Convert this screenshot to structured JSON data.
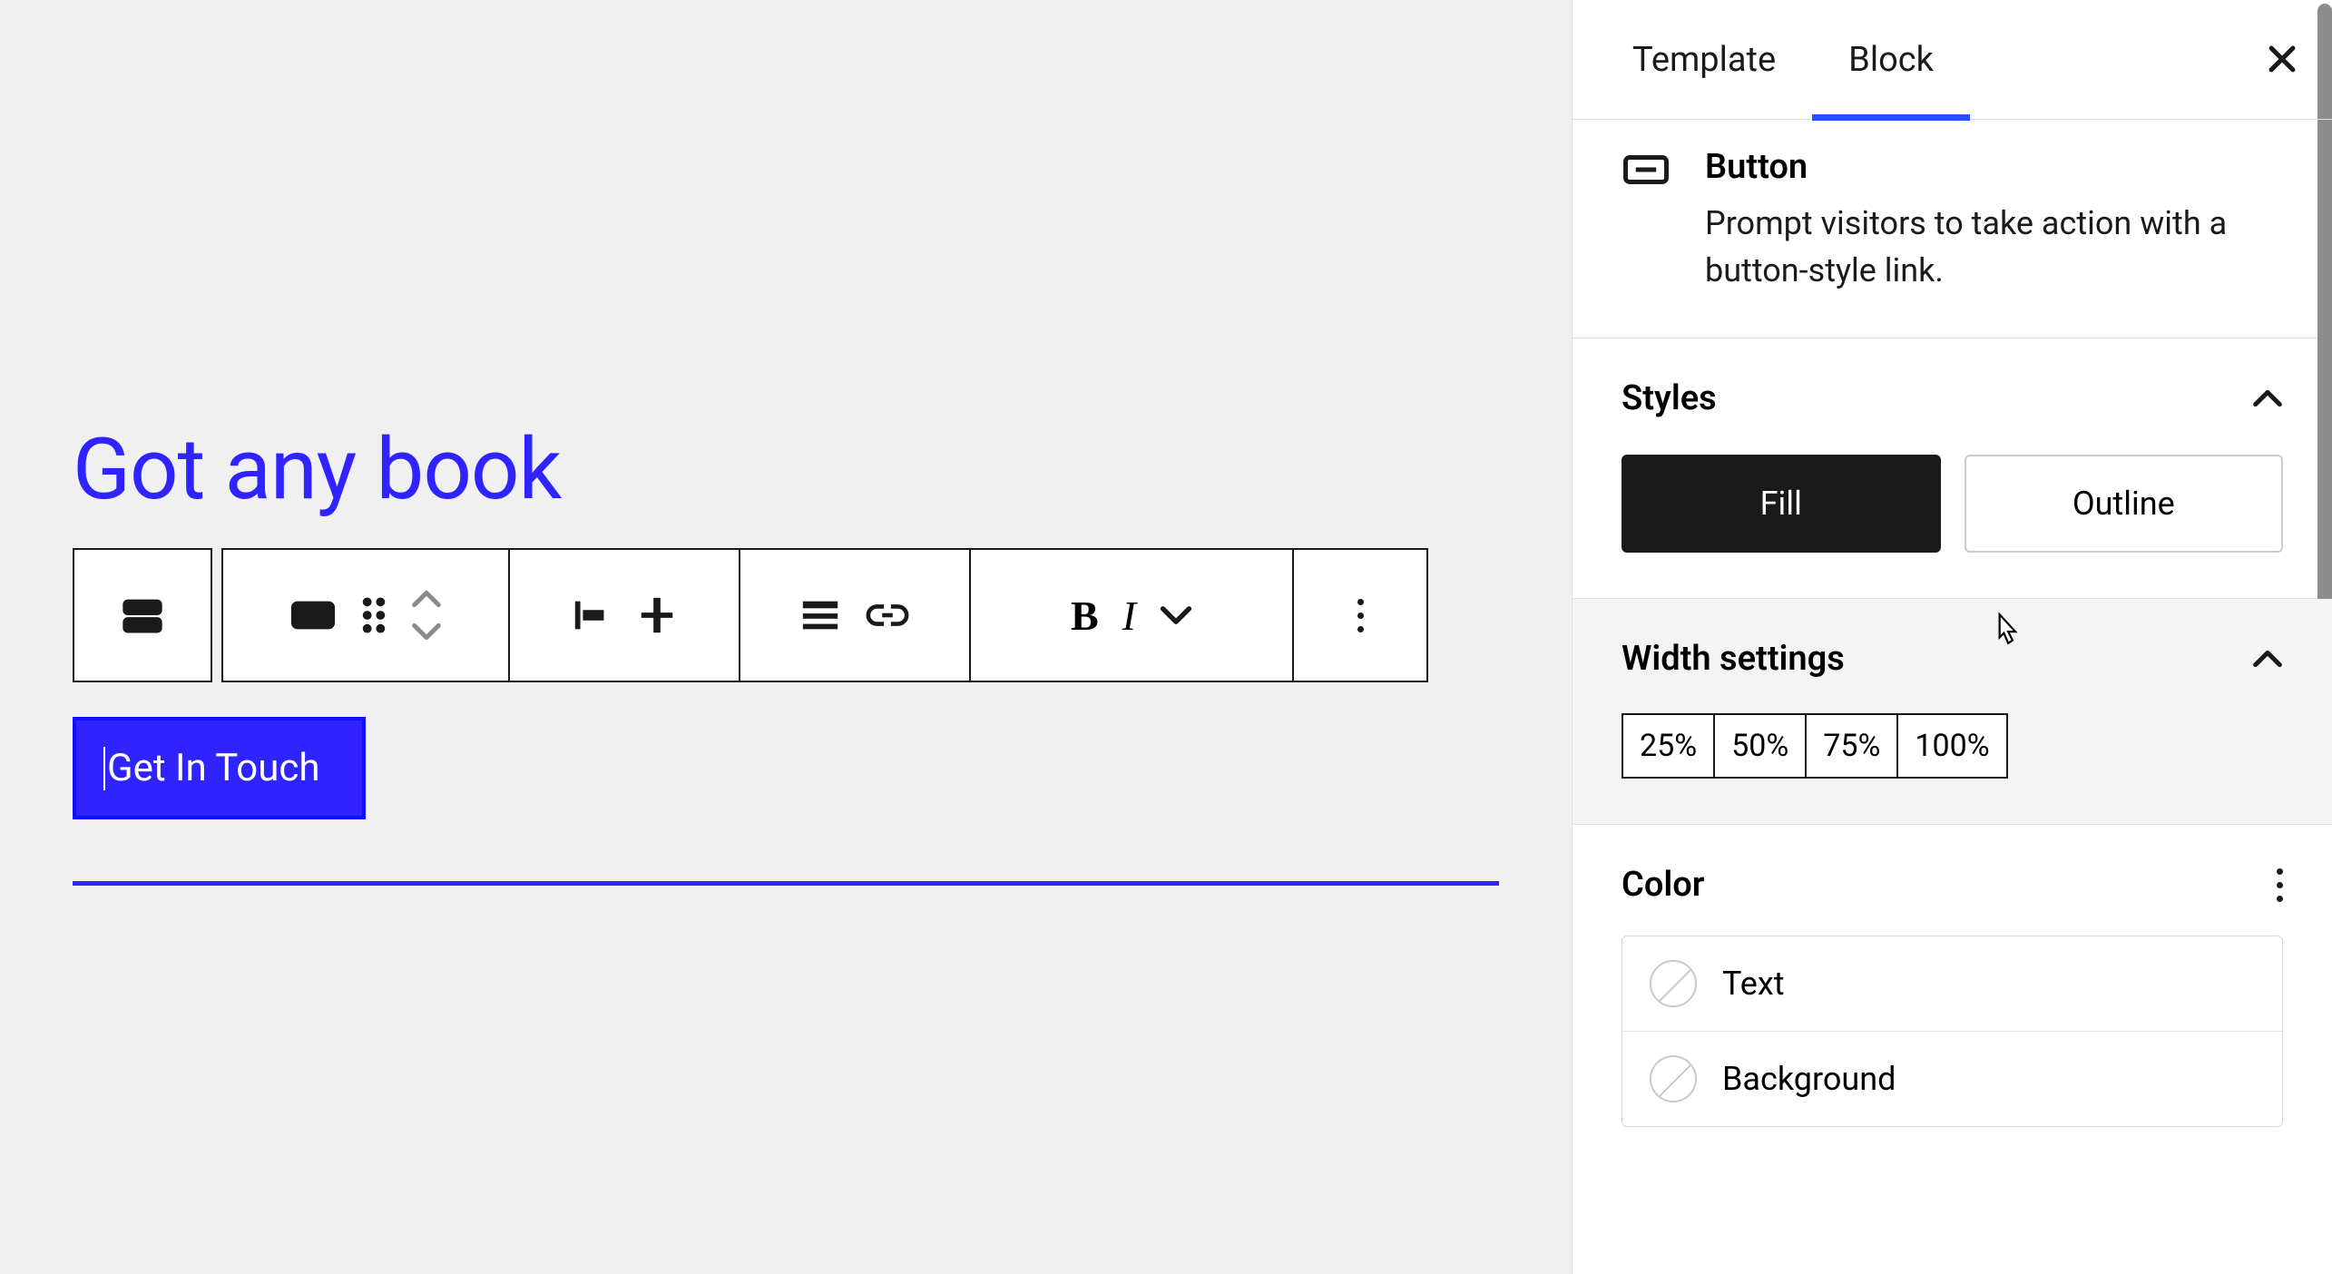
{
  "editor": {
    "heading": "Got any book",
    "button_label": "Get In Touch"
  },
  "toolbar": {
    "block_type": "button-block-icon",
    "transform": "button-icon",
    "drag": "drag-icon",
    "move_up": "chevron-up-icon",
    "move_down": "chevron-down-icon",
    "justify": "justify-left-icon",
    "align_v": "align-top-icon",
    "align": "align-icon",
    "link": "link-icon",
    "bold": "B",
    "italic": "I",
    "more_format": "chevron-down-icon",
    "options": "more-options-icon"
  },
  "sidebar": {
    "tabs": {
      "template": "Template",
      "block": "Block",
      "active": "block"
    },
    "block": {
      "name": "Button",
      "description": "Prompt visitors to take action with a button-style link."
    },
    "styles": {
      "title": "Styles",
      "options": {
        "fill": "Fill",
        "outline": "Outline"
      },
      "active": "fill"
    },
    "width": {
      "title": "Width settings",
      "options": [
        "25%",
        "50%",
        "75%",
        "100%"
      ]
    },
    "color": {
      "title": "Color",
      "items": {
        "text": "Text",
        "background": "Background"
      }
    }
  }
}
